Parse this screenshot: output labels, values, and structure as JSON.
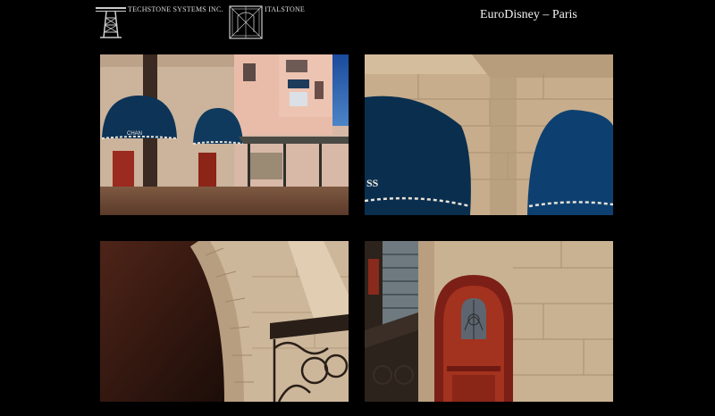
{
  "header": {
    "logo_techstone_text": "TECHSTONE SYSTEMS INC.",
    "logo_italstone_text": "ITALSTONE",
    "page_title": "EuroDisney – Paris"
  },
  "photos": [
    {
      "id": "p1",
      "sign_text": "CHAN"
    },
    {
      "id": "p2",
      "sign_text": "SS"
    },
    {
      "id": "p3"
    },
    {
      "id": "p4"
    }
  ],
  "colors": {
    "background": "#000000",
    "awning_blue": "#0c3556",
    "stone_beige": "#c8b393",
    "pink_facade": "#e5b9a8",
    "sky_blue": "#1e5aa8",
    "red_trim": "#8a2418"
  }
}
